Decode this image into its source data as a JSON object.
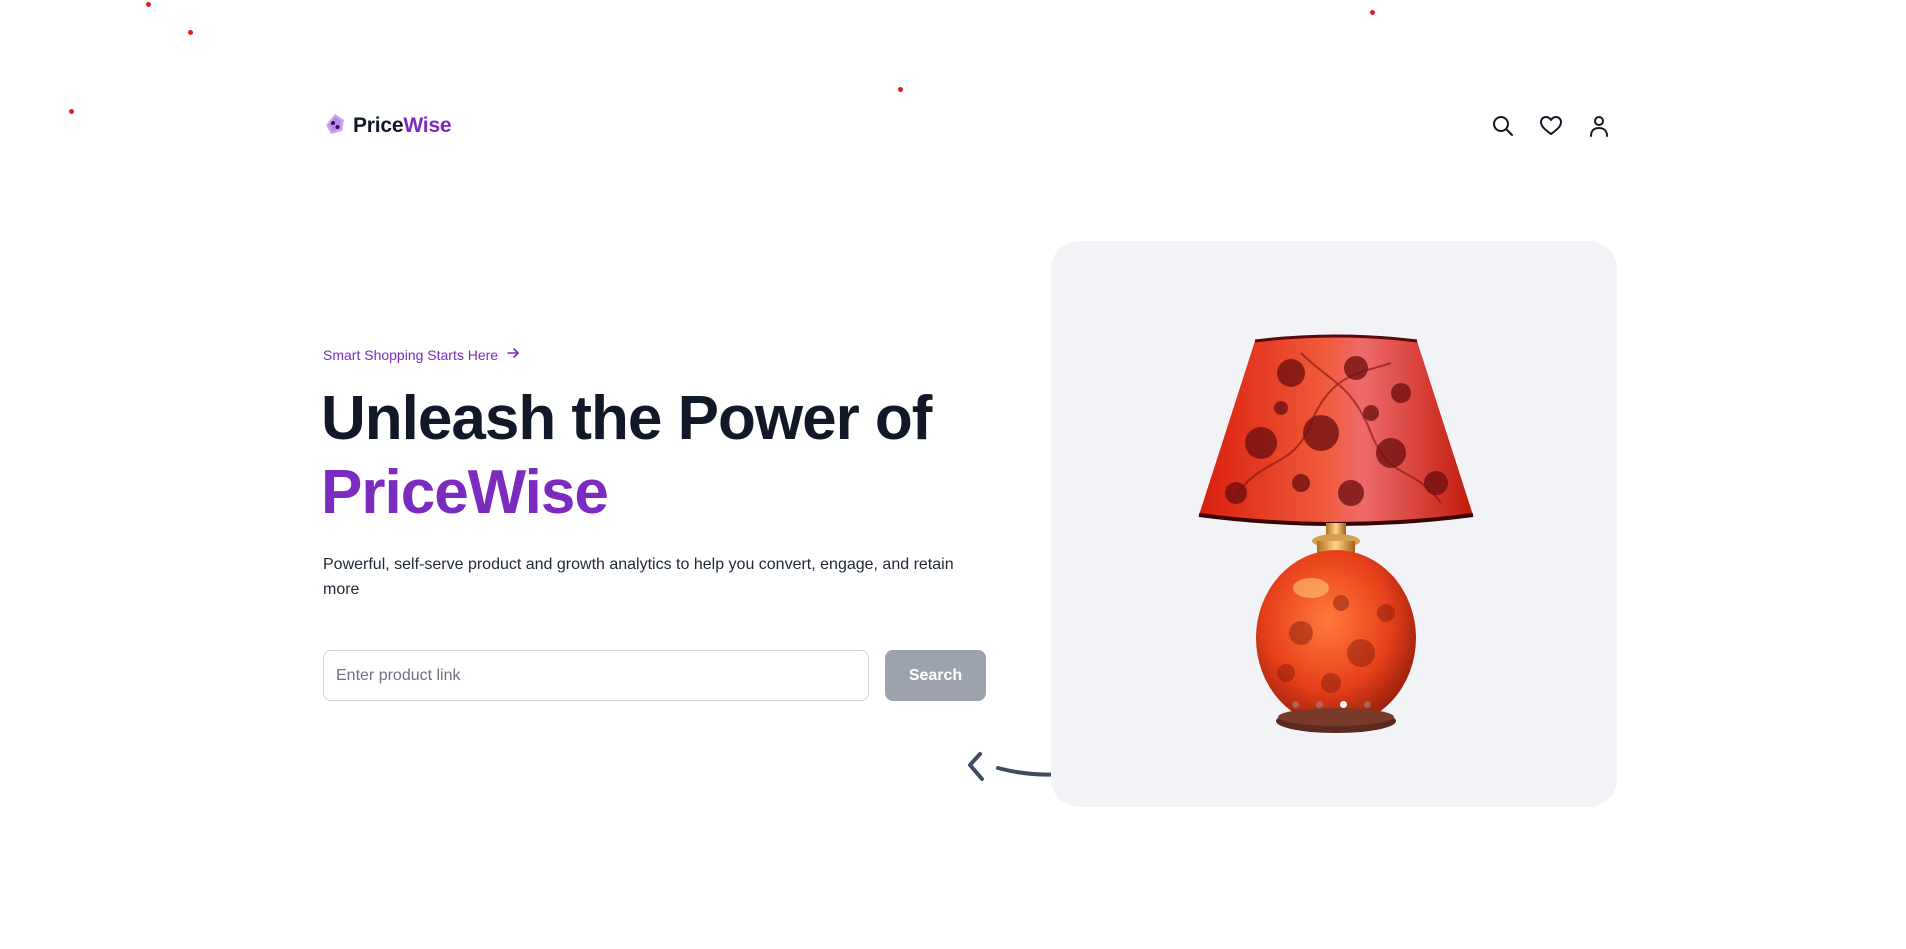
{
  "brand": {
    "part1": "Price",
    "part2": "Wise",
    "accent": "#7b2cbf"
  },
  "nav": {
    "icons": [
      "search-icon",
      "heart-icon",
      "user-icon"
    ]
  },
  "hero": {
    "tagline": "Smart Shopping Starts Here",
    "title_line1": "Unleash the Power of",
    "title_line2": "PriceWise",
    "subtitle": "Powerful, self-serve product and growth analytics to help you convert, engage, and retain more"
  },
  "search": {
    "placeholder": "Enter product link",
    "value": "",
    "button_label": "Search"
  },
  "carousel": {
    "slide_count": 4,
    "active_index": 2,
    "product": "lamp"
  }
}
